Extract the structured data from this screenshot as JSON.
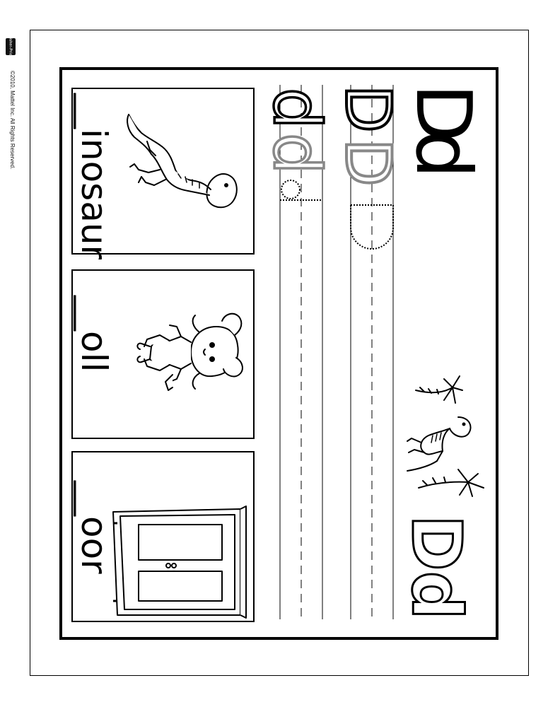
{
  "brand": {
    "badge_text": "Fisher-Price"
  },
  "copyright": "©2010, Mattel Inc.    All Rights Reserved.",
  "title": {
    "uppercase": "D",
    "lowercase": "d"
  },
  "title_outline": "Dd",
  "tracing": {
    "uppercase_solid": "D",
    "uppercase_gray": "D",
    "lowercase_solid": "d",
    "lowercase_gray": "d"
  },
  "cards": [
    {
      "word": "__inosaur",
      "picture": "dinosaur-icon"
    },
    {
      "word": "__oll",
      "picture": "doll-icon"
    },
    {
      "word": "__oor",
      "picture": "door-icon"
    }
  ]
}
